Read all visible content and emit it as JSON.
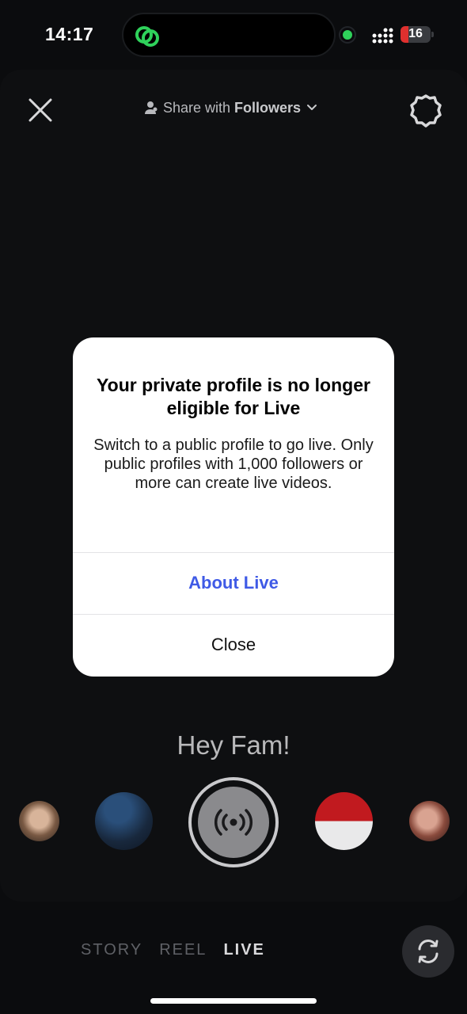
{
  "status_bar": {
    "time": "14:17",
    "battery": "16"
  },
  "header": {
    "share_prefix": "Share with",
    "share_audience": "Followers"
  },
  "dialog": {
    "title": "Your private profile is no longer eligible for Live",
    "body": "Switch to a public profile to go live. Only public profiles with 1,000 followers or more can create live videos.",
    "primary_button": "About Live",
    "secondary_button": "Close"
  },
  "prompt_text": "Hey Fam!",
  "modes": [
    "STORY",
    "REEL",
    "LIVE"
  ],
  "selected_mode": "LIVE",
  "colors": {
    "accent_blue": "#3f5ae6",
    "recording_green": "#2fd25b",
    "battery_red": "#e0302e"
  },
  "icons": [
    "close-icon",
    "person-icon",
    "chevron-down-icon",
    "gear-icon",
    "live-broadcast-icon",
    "flip-camera-icon",
    "link-icon"
  ]
}
